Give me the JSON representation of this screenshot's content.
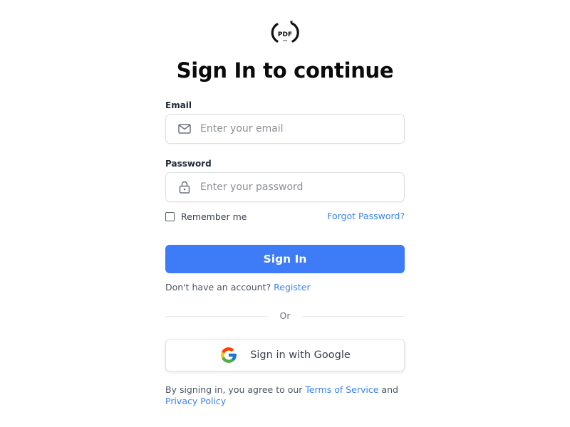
{
  "logo": {
    "text": "PDF",
    "subtext": "▪▪▪"
  },
  "title": "Sign In to continue",
  "email": {
    "label": "Email",
    "placeholder": "Enter your email",
    "value": "",
    "icon": "mail-icon"
  },
  "password": {
    "label": "Password",
    "placeholder": "Enter your password",
    "value": "",
    "icon": "lock-icon"
  },
  "remember": {
    "label": "Remember me",
    "checked": false
  },
  "forgot_password": "Forgot Password?",
  "signin_button": "Sign In",
  "register": {
    "prompt": "Don't have an account?",
    "link": "Register"
  },
  "divider": "Or",
  "google_button": {
    "label": "Sign in with Google",
    "icon": "google-icon"
  },
  "terms": {
    "prefix": "By signing in, you agree to our",
    "tos": "Terms of Service",
    "and": "and",
    "privacy": "Privacy Policy"
  },
  "colors": {
    "primary": "#3e7bf6",
    "link": "#3b82f6"
  }
}
